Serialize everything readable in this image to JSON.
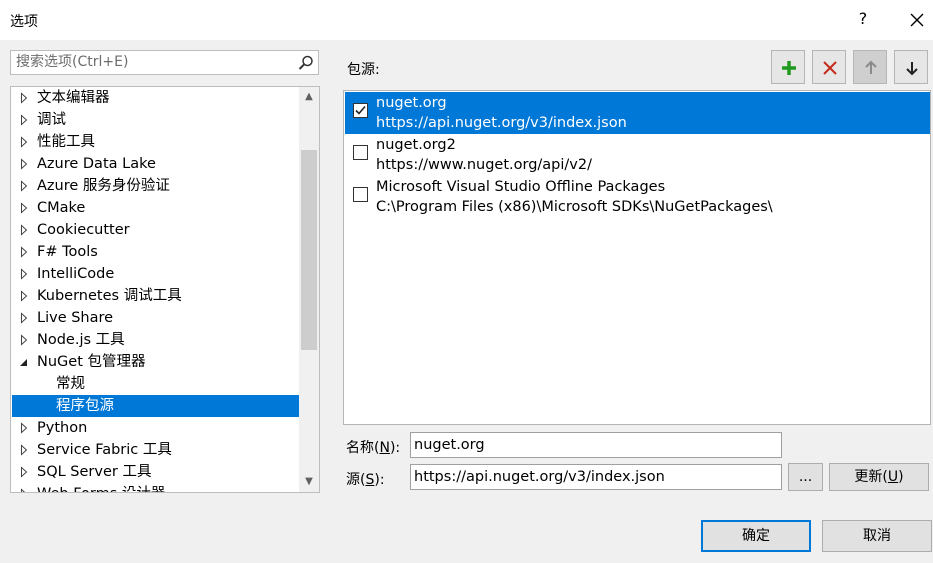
{
  "dialog": {
    "title": "选项",
    "help": "?",
    "close_icon": "close-icon"
  },
  "search": {
    "placeholder": "搜索选项(Ctrl+E)"
  },
  "tree": {
    "items": [
      {
        "label": "文本编辑器",
        "expanded": false
      },
      {
        "label": "调试",
        "expanded": false
      },
      {
        "label": "性能工具",
        "expanded": false
      },
      {
        "label": "Azure Data Lake",
        "expanded": false
      },
      {
        "label": "Azure 服务身份验证",
        "expanded": false
      },
      {
        "label": "CMake",
        "expanded": false
      },
      {
        "label": "Cookiecutter",
        "expanded": false
      },
      {
        "label": "F# Tools",
        "expanded": false
      },
      {
        "label": "IntelliCode",
        "expanded": false
      },
      {
        "label": "Kubernetes 调试工具",
        "expanded": false
      },
      {
        "label": "Live Share",
        "expanded": false
      },
      {
        "label": "Node.js 工具",
        "expanded": false
      },
      {
        "label": "NuGet 包管理器",
        "expanded": true
      },
      {
        "label": "常规",
        "child": true
      },
      {
        "label": "程序包源",
        "child": true,
        "selected": true
      },
      {
        "label": "Python",
        "expanded": false
      },
      {
        "label": "Service Fabric 工具",
        "expanded": false
      },
      {
        "label": "SQL Server 工具",
        "expanded": false
      },
      {
        "label": "Web Forms 设计器",
        "expanded": false
      }
    ]
  },
  "sources": {
    "label": "包源:",
    "toolbar": {
      "add_icon": "plus-icon",
      "remove_icon": "x-icon",
      "up_icon": "arrow-up-icon",
      "down_icon": "arrow-down-icon"
    },
    "packages": [
      {
        "name": "nuget.org",
        "url": "https://api.nuget.org/v3/index.json",
        "checked": true,
        "selected": true
      },
      {
        "name": "nuget.org2",
        "url": "https://www.nuget.org/api/v2/",
        "checked": false,
        "selected": false
      },
      {
        "name": "Microsoft Visual Studio Offline Packages",
        "url": "C:\\Program Files (x86)\\Microsoft SDKs\\NuGetPackages\\",
        "checked": false,
        "selected": false
      }
    ]
  },
  "form": {
    "name_label": "名称(",
    "name_key": "N",
    "name_label_end": "):",
    "name_value": "nuget.org",
    "source_label": "源(",
    "source_key": "S",
    "source_label_end": "):",
    "source_value": "https://api.nuget.org/v3/index.json",
    "browse_label": "...",
    "update_label": "更新(",
    "update_key": "U",
    "update_label_end": ")"
  },
  "footer": {
    "ok_label": "确定",
    "cancel_label": "取消"
  }
}
